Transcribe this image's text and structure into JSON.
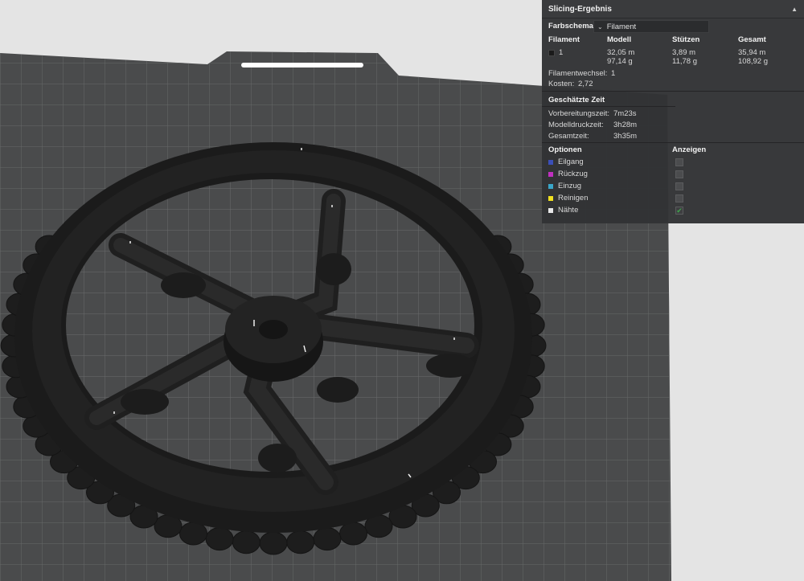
{
  "panel": {
    "title": "Slicing-Ergebnis",
    "color_scheme_label": "Farbschema",
    "color_scheme_value": "Filament",
    "table_headers": [
      "Filament",
      "Modell",
      "Stützen",
      "Gesamt"
    ],
    "filament_row": {
      "filament_id": "1",
      "model_length": "32,05 m",
      "model_weight": "97,14 g",
      "supports_length": "3,89 m",
      "supports_weight": "11,78 g",
      "total_length": "35,94 m",
      "total_weight": "108,92 g"
    },
    "filament_changes_label": "Filamentwechsel:",
    "filament_changes_value": "1",
    "cost_label": "Kosten:",
    "cost_value": "2,72",
    "estimated_time_title": "Geschätzte Zeit",
    "prep_time_label": "Vorbereitungszeit:",
    "prep_time_value": "7m23s",
    "print_time_label": "Modelldruckzeit:",
    "print_time_value": "3h28m",
    "total_time_label": "Gesamtzeit:",
    "total_time_value": "3h35m",
    "options_header": "Optionen",
    "show_header": "Anzeigen",
    "options": [
      {
        "label": "Eilgang",
        "color": "#3b4fb8",
        "shown": false
      },
      {
        "label": "Rückzug",
        "color": "#c030c0",
        "shown": false
      },
      {
        "label": "Einzug",
        "color": "#3aa6c8",
        "shown": false
      },
      {
        "label": "Reinigen",
        "color": "#f0e020",
        "shown": false
      },
      {
        "label": "Nähte",
        "color": "#e8e8e8",
        "shown": true
      }
    ]
  },
  "colors": {
    "plate": "#4a4b4c",
    "grid": "#6a6b6c",
    "model": "#1b1b1b",
    "panel_bg": "#323335",
    "background": "#e4e4e4"
  }
}
